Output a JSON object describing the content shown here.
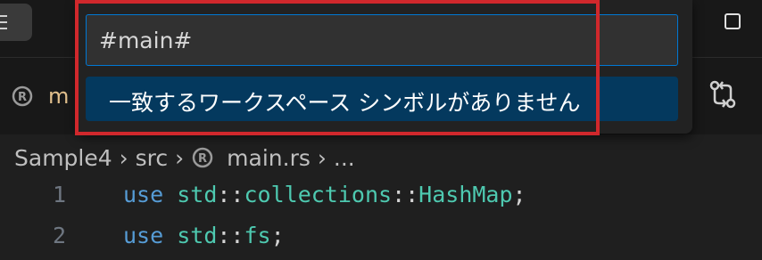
{
  "tab": {
    "label_partial": "m"
  },
  "breadcrumb": {
    "items": [
      "Sample4",
      "src",
      "main.rs",
      "..."
    ]
  },
  "editor": {
    "lines": [
      {
        "number": "1",
        "tokens": [
          "use",
          " ",
          "std",
          "::",
          "collections",
          "::",
          "HashMap",
          ";"
        ]
      },
      {
        "number": "2",
        "tokens": [
          "use",
          " ",
          "std",
          "::",
          "fs",
          ";"
        ]
      }
    ]
  },
  "quick_pick": {
    "input_value": "#main#",
    "message": "一致するワークスペース シンボルがありません"
  },
  "colors": {
    "accent": "#0078d4",
    "selection": "#04395e",
    "highlight_box": "#d0282c"
  }
}
